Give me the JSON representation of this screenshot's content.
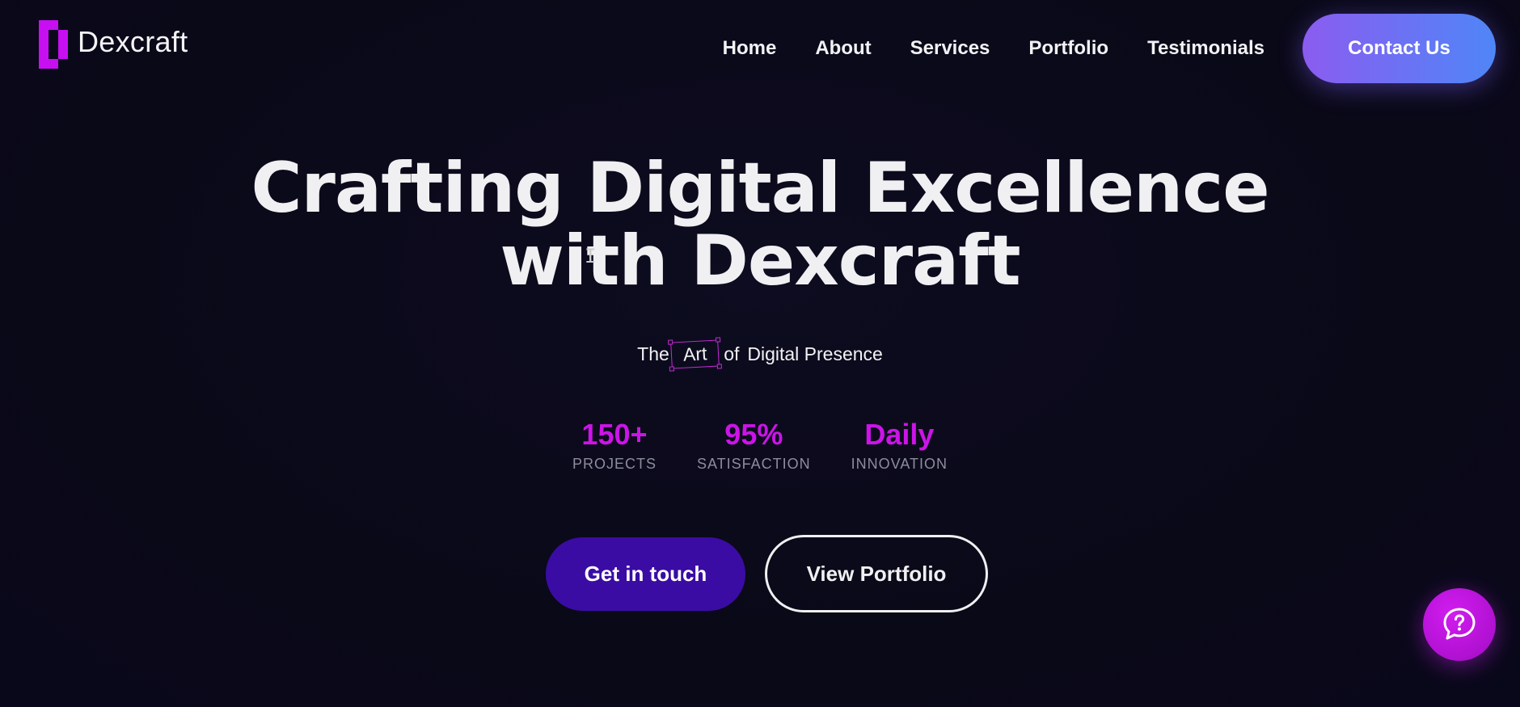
{
  "brand": {
    "name": "Dexcraft",
    "accent": "#c70ff2"
  },
  "nav": {
    "items": [
      {
        "label": "Home"
      },
      {
        "label": "About"
      },
      {
        "label": "Services"
      },
      {
        "label": "Portfolio"
      },
      {
        "label": "Testimonials"
      }
    ],
    "contact_label": "Contact Us"
  },
  "hero": {
    "title_line1": "Crafting Digital Excellence",
    "title_line2": "with Dexcraft",
    "tagline": {
      "the": "The",
      "art": "Art",
      "of": "of",
      "rest": "Digital Presence"
    }
  },
  "stats": [
    {
      "value": "150+",
      "label": "PROJECTS"
    },
    {
      "value": "95%",
      "label": "SATISFACTION"
    },
    {
      "value": "Daily",
      "label": "INNOVATION"
    }
  ],
  "cta": {
    "primary": "Get in touch",
    "secondary": "View Portfolio"
  },
  "icons": {
    "help": "help-chat-icon",
    "cursor": "text-cursor-icon"
  },
  "colors": {
    "background": "#0b0a1c",
    "stat_value": "#cc14e8",
    "primary_button": "#3a0ca3",
    "contact_gradient_start": "#8b5cf0",
    "contact_gradient_end": "#4f86f7",
    "help_button": "#c414e6"
  }
}
